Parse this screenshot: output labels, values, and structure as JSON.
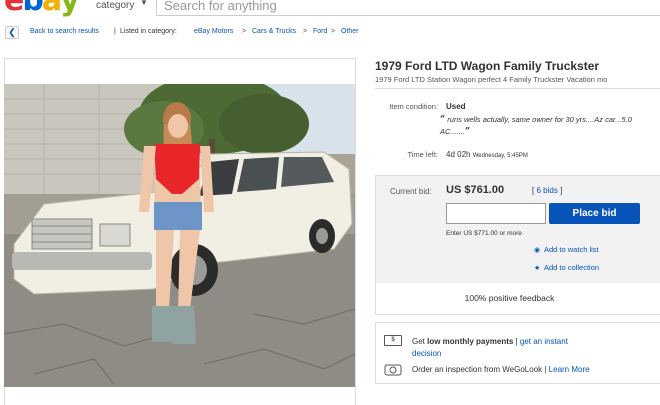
{
  "header": {
    "logo_letters": [
      "e",
      "b",
      "a",
      "y"
    ],
    "logo_colors": [
      "#e53238",
      "#0064d2",
      "#f5af02",
      "#86b817"
    ],
    "category_label": "category",
    "search_placeholder": "Search for anything"
  },
  "breadcrumb": {
    "back_label": "Back to search results",
    "separator": "|",
    "listed_in": "Listed in category:",
    "items": [
      "eBay Motors",
      "Cars & Trucks",
      "Ford",
      "Other"
    ],
    "arrow": ">"
  },
  "item": {
    "title": "1979 Ford LTD Wagon Family Truckster",
    "subtitle": "1979 Ford LTD Station Wagon perfect 4 Family Truckster Vacation mo",
    "condition_label": "Item condition:",
    "condition_value": "Used",
    "seller_note_open": "“",
    "seller_note": " runs wells actually, same owner for 30 yrs....Az car...5.0 AC.......",
    "seller_note_close": "”",
    "time_left_label": "Time left:",
    "time_left_value": "4d 02h",
    "time_left_detail": "Wednesday, 5:45PM"
  },
  "bid": {
    "current_bid_label": "Current bid:",
    "current_bid_value": "US $761.00",
    "bids_open": "[",
    "bids_count": "6 bids",
    "bids_close": "]",
    "input_value": "",
    "place_bid_label": "Place bid",
    "enter_note": "Enter US $771.00 or more",
    "watch_label": "Add to watch list",
    "collection_label": "Add to collection",
    "feedback": "100% positive feedback"
  },
  "promo": {
    "line1_prefix": "Get ",
    "line1_bold": "low monthly payments",
    "line1_sep": " | ",
    "line1_link": "get an instant",
    "line2_link": "decision",
    "line3_text": "Order an inspection from WeGoLook",
    "line3_sep": " | ",
    "line3_link": "Learn More"
  },
  "colors": {
    "link": "#0654ba",
    "button": "#0654ba"
  }
}
